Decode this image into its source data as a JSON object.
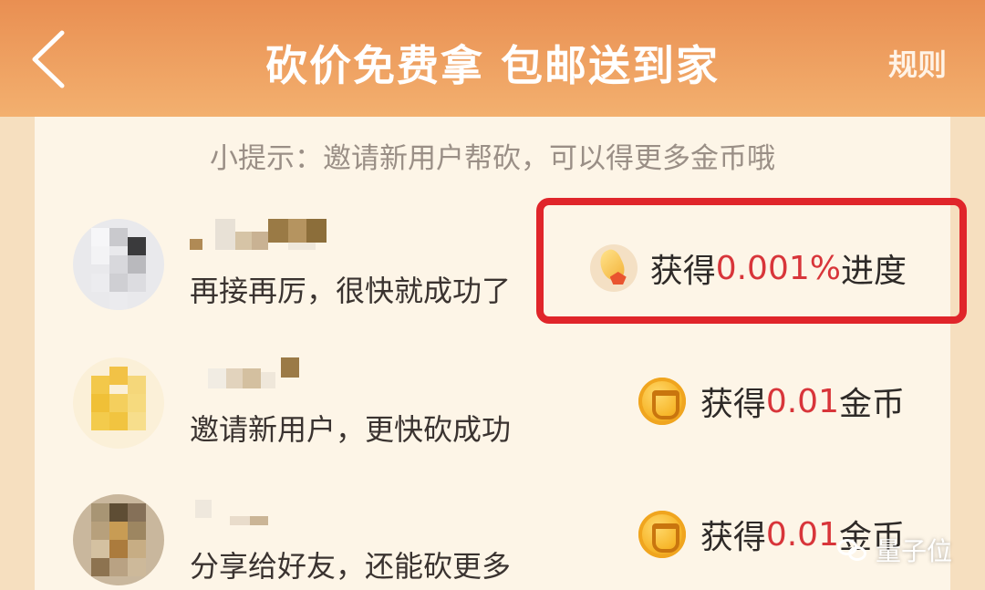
{
  "header": {
    "title": "砍价免费拿 包邮送到家",
    "rules_label": "规则",
    "back_icon": "chevron-left-icon"
  },
  "tip": "小提示：邀请新用户帮砍，可以得更多金币哦",
  "rows": [
    {
      "message": "再接再厉，很快就成功了",
      "reward_prefix": "获得",
      "reward_value": "0.001%",
      "reward_suffix": "进度",
      "icon": "progress-icon"
    },
    {
      "message": "邀请新用户，更快砍成功",
      "reward_prefix": "获得",
      "reward_value": "0.01",
      "reward_suffix": "金币",
      "icon": "coin-icon"
    },
    {
      "message": "分享给好友，还能砍更多",
      "reward_prefix": "获得",
      "reward_value": "0.01",
      "reward_suffix": "金币",
      "icon": "coin-icon"
    }
  ],
  "watermark": "量子位",
  "colors": {
    "header_top": "#e98f52",
    "header_bottom": "#f3b06f",
    "highlight": "#e0252a",
    "reward_value": "#d8353a"
  }
}
